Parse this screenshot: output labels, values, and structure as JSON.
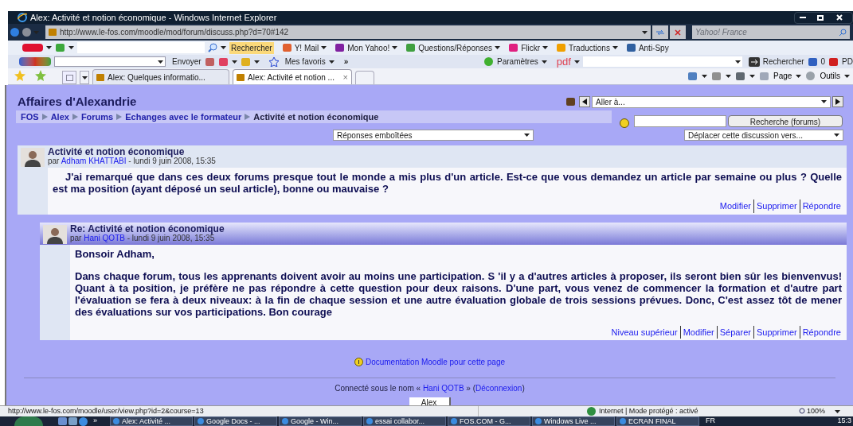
{
  "window": {
    "title": "Alex: Activité et notion économique - Windows Internet Explorer"
  },
  "address_bar": {
    "url": "http://www.le-fos.com/moodle/mod/forum/discuss.php?d=70#142",
    "search_placeholder": "Yahoo! France"
  },
  "yahoo_toolbar": {
    "search_button": "Rechercher",
    "items": [
      "Y! Mail",
      "Mon Yahoo!",
      "Questions/Réponses",
      "Flickr",
      "Traductions",
      "Anti-Spy"
    ]
  },
  "google_toolbar": {
    "send": "Envoyer",
    "favorites": "Mes favoris",
    "more": "»",
    "settings": "Paramètres",
    "pdf": "pdf",
    "search": "Rechercher",
    "count": "0",
    "cut": "PD"
  },
  "tabs": [
    {
      "label": "Alex: Quelques informatio...",
      "selected": false
    },
    {
      "label": "Alex: Activité et notion ...",
      "selected": true,
      "close": "×"
    }
  ],
  "command_bar": {
    "page": "Page",
    "tools": "Outils"
  },
  "page": {
    "site_title": "Affaires d'Alexandrie",
    "jump_select": "Aller à...",
    "breadcrumb": [
      "FOS",
      "Alex",
      "Forums",
      "Echanges avec le formateur",
      "Activité et notion économique"
    ],
    "search_button": "Recherche (forums)",
    "display_select": "Réponses emboîtées",
    "move_select": "Déplacer cette discussion vers...",
    "posts": [
      {
        "title": "Activité et notion économique",
        "by": "par",
        "author": "Adham KHATTABI",
        "date": " - lundi 9 juin 2008, 15:35",
        "paragraphs": [
          "J'ai remarqué que dans ces deux forums presque tout le monde a mis plus d'un article. Est-ce que vous demandez un article par semaine ou plus ? Quelle est ma position (ayant déposé un seul article), bonne ou mauvaise ?"
        ],
        "links": [
          "Modifier",
          "Supprimer",
          "Répondre"
        ],
        "children": [
          {
            "title": "Re: Activité et notion économique",
            "by": "par",
            "author": "Hani QOTB",
            "date": " - lundi 9 juin 2008, 15:35",
            "paragraphs": [
              "Bonsoir Adham,",
              "Dans chaque forum, tous les apprenants doivent avoir au moins une participation. S 'il y a d'autres articles à proposer, ils seront bien sûr les bienvenvus! Quant à ta position, je préfère ne pas répondre à cette question pour deux raisons. D'une part, vous venez de commencer la formation et d'autre part l'évaluation se fera à deux niveaux: à la fin de chaque session et une autre évaluation globale de trois sessions prévues. Donc, C'est assez tôt de mener des évaluations sur vos participations. Bon courage"
            ],
            "links": [
              "Niveau supérieur",
              "Modifier",
              "Séparer",
              "Supprimer",
              "Répondre"
            ]
          }
        ]
      }
    ],
    "doc_link": "Documentation Moodle pour cette page",
    "login": {
      "before": "Connecté sous le nom « ",
      "user": "Hani QOTB",
      "middle": " » (",
      "logout": "Déconnexion",
      "after": ")"
    },
    "bottom_button": "Alex"
  },
  "status_bar": {
    "url": "http://www.le-fos.com/moodle/user/view.php?id=2&course=13",
    "zone": "Internet | Mode protégé : activé",
    "zoom": "100%"
  },
  "taskbar": {
    "more": "»",
    "items": [
      "Alex: Activité ...",
      "Google Docs - ...",
      "Google - Win...",
      "essai collabor...",
      "FOS.COM - G...",
      "Windows Live ...",
      "ECRAN FINAL"
    ],
    "lang": "FR",
    "clock": "15:3"
  }
}
